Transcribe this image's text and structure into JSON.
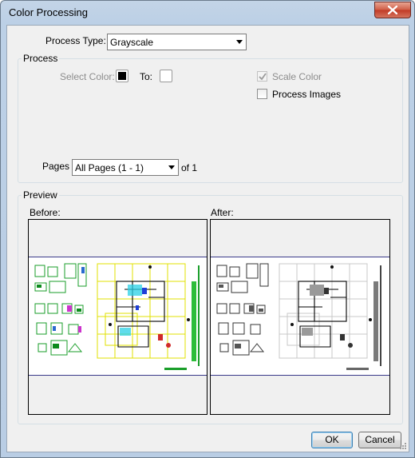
{
  "window": {
    "title": "Color Processing"
  },
  "process_type": {
    "label": "Process Type:",
    "value": "Grayscale"
  },
  "process_group": {
    "label": "Process",
    "select_color_label": "Select Color:",
    "from_color": "#000000",
    "to_label": "To:",
    "to_color": "#ffffff",
    "scale_color": {
      "label": "Scale Color",
      "checked": true,
      "enabled": false
    },
    "process_images": {
      "label": "Process Images",
      "checked": false,
      "enabled": true
    },
    "pages_label": "Pages",
    "pages_value": "All Pages (1 - 1)",
    "of_label": "of 1"
  },
  "preview_group": {
    "label": "Preview",
    "before_label": "Before:",
    "after_label": "After:"
  },
  "buttons": {
    "ok": "OK",
    "cancel": "Cancel"
  }
}
